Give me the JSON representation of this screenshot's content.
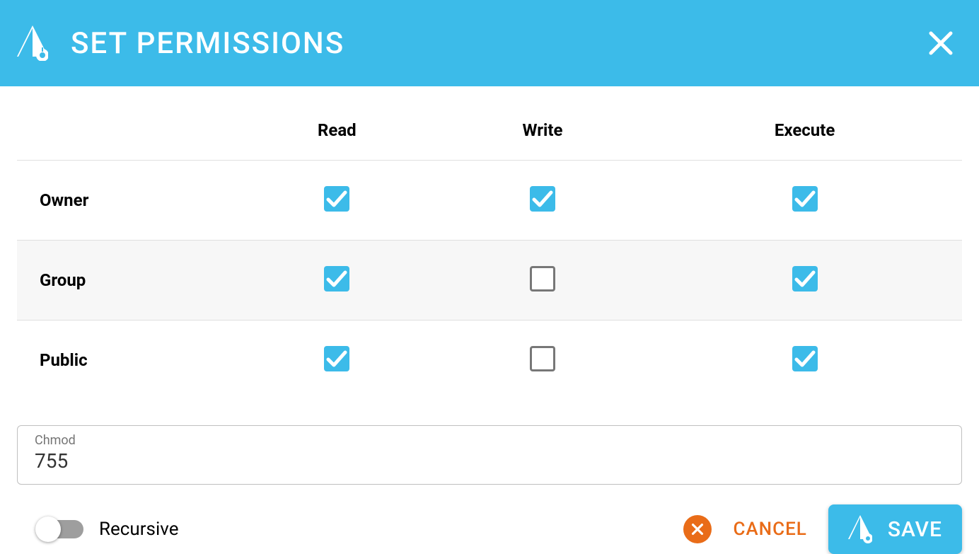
{
  "header": {
    "title": "SET PERMISSIONS"
  },
  "columns": [
    "Read",
    "Write",
    "Execute"
  ],
  "rows": [
    {
      "label": "Owner",
      "read": true,
      "write": true,
      "execute": true
    },
    {
      "label": "Group",
      "read": true,
      "write": false,
      "execute": true
    },
    {
      "label": "Public",
      "read": true,
      "write": false,
      "execute": true
    }
  ],
  "chmod": {
    "label": "Chmod",
    "value": "755"
  },
  "recursive": {
    "label": "Recursive",
    "enabled": false
  },
  "buttons": {
    "cancel": "CANCEL",
    "save": "SAVE"
  }
}
